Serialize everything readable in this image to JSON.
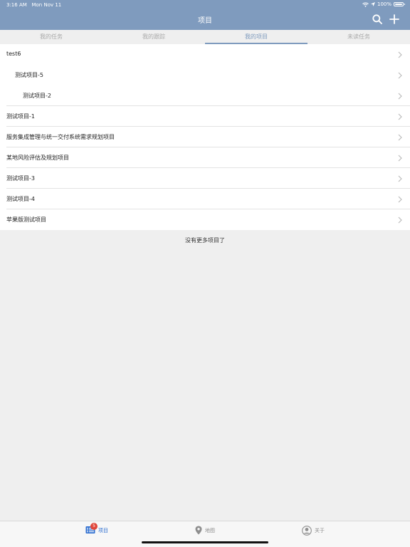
{
  "status_bar": {
    "time": "3:16 AM",
    "date": "Mon Nov 11",
    "battery": "100%"
  },
  "header": {
    "title": "项目",
    "search_icon": "search-icon",
    "add_icon": "plus-icon"
  },
  "tabs": [
    {
      "label": "我的任务",
      "active": false
    },
    {
      "label": "我的跟踪",
      "active": false
    },
    {
      "label": "我的项目",
      "active": true
    },
    {
      "label": "未读任务",
      "active": false
    }
  ],
  "projects": [
    {
      "name": "test6",
      "level": 0
    },
    {
      "name": "测试项目-5",
      "level": 1
    },
    {
      "name": "测试项目-2",
      "level": 2
    },
    {
      "name": "测试项目-1",
      "level": 0
    },
    {
      "name": "服务集成管理与统一交付系统需求规划项目",
      "level": 0
    },
    {
      "name": "某地风险评估及规划项目",
      "level": 0
    },
    {
      "name": "测试项目-3",
      "level": 0
    },
    {
      "name": "测试项目-4",
      "level": 0
    },
    {
      "name": "苹果版测试项目",
      "level": 0
    }
  ],
  "list_footer": "没有更多项目了",
  "tabbar": {
    "projects_label": "项目",
    "projects_badge": "5",
    "map_label": "地图",
    "about_label": "关于"
  },
  "colors": {
    "accent": "#7f9bbe",
    "tab_active": "#2f6fd0",
    "badge": "#e0463a"
  }
}
